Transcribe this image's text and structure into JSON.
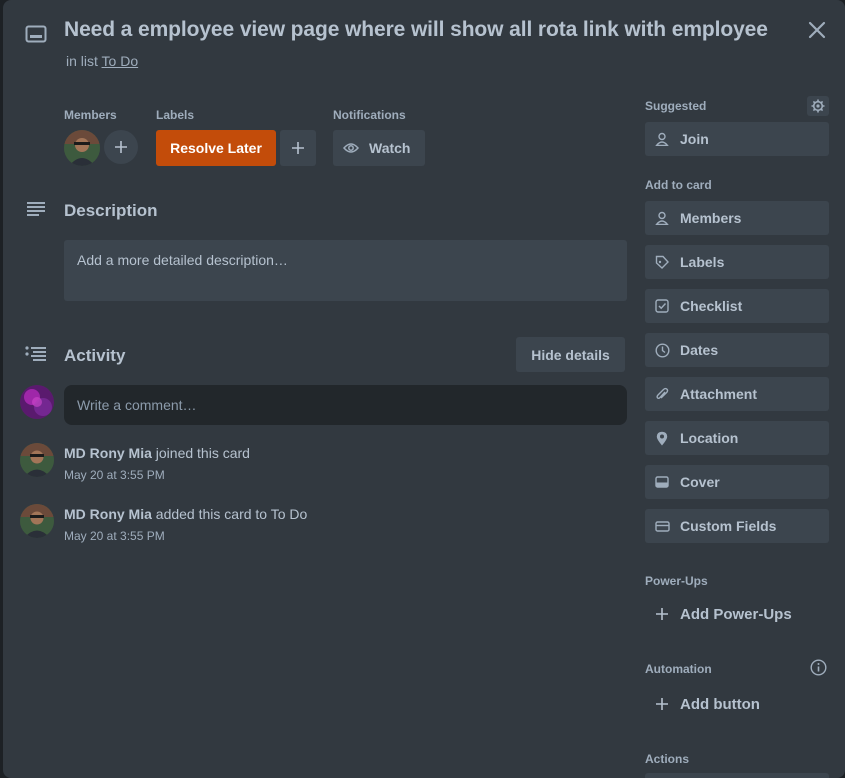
{
  "card": {
    "title": "Need a employee view page where will show all rota link with employee",
    "in_list_prefix": "in list",
    "list_name": "To Do"
  },
  "members": {
    "heading": "Members"
  },
  "labels": {
    "heading": "Labels",
    "items": [
      {
        "text": "Resolve Later",
        "color": "#c34c0a"
      }
    ]
  },
  "notifications": {
    "heading": "Notifications",
    "watch_label": "Watch"
  },
  "description": {
    "heading": "Description",
    "placeholder": "Add a more detailed description…"
  },
  "activity": {
    "heading": "Activity",
    "hide_details_label": "Hide details",
    "comment_placeholder": "Write a comment…",
    "items": [
      {
        "user": "MD Rony Mia",
        "action": "joined this card",
        "time": "May 20 at 3:55 PM"
      },
      {
        "user": "MD Rony Mia",
        "action": "added this card to To Do",
        "time": "May 20 at 3:55 PM"
      }
    ]
  },
  "sidebar": {
    "suggested_heading": "Suggested",
    "join_label": "Join",
    "add_to_card_heading": "Add to card",
    "add_items": [
      {
        "label": "Members",
        "icon": "person-icon"
      },
      {
        "label": "Labels",
        "icon": "tag-icon"
      },
      {
        "label": "Checklist",
        "icon": "checkbox-icon"
      },
      {
        "label": "Dates",
        "icon": "clock-icon"
      },
      {
        "label": "Attachment",
        "icon": "paperclip-icon"
      },
      {
        "label": "Location",
        "icon": "location-pin-icon"
      },
      {
        "label": "Cover",
        "icon": "cover-icon"
      },
      {
        "label": "Custom Fields",
        "icon": "custom-fields-icon"
      }
    ],
    "powerups_heading": "Power-Ups",
    "add_powerups_label": "Add Power-Ups",
    "automation_heading": "Automation",
    "add_button_label": "Add button",
    "actions_heading": "Actions"
  },
  "colors": {
    "modal_bg": "#323940",
    "button_bg": "#3c454e",
    "label_orange": "#c34c0a",
    "text": "#b6c2cf"
  }
}
